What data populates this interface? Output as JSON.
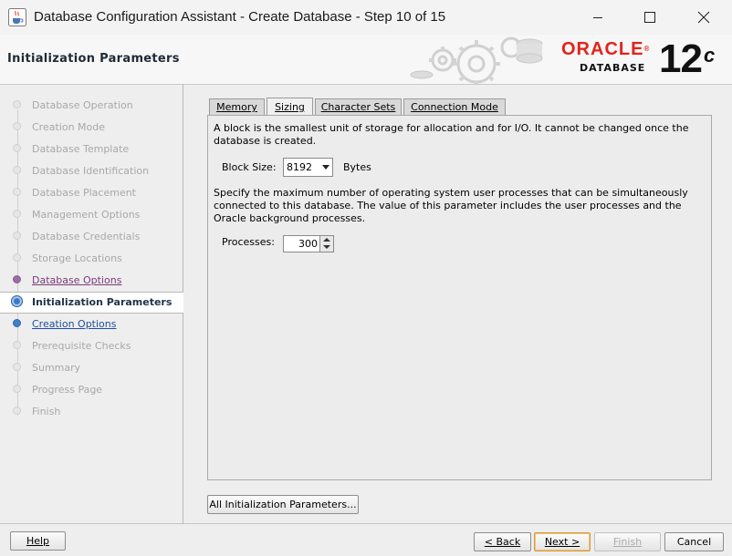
{
  "window": {
    "title": "Database Configuration Assistant - Create Database - Step 10 of 15",
    "icon": "java-coffee-icon"
  },
  "header": {
    "page_title": "Initialization Parameters",
    "brand_name": "ORACLE",
    "brand_reg": "®",
    "brand_product": "DATABASE",
    "version": "12",
    "version_suffix": "c"
  },
  "steps": [
    {
      "label": "Database Operation",
      "state": "disabled"
    },
    {
      "label": "Creation Mode",
      "state": "disabled"
    },
    {
      "label": "Database Template",
      "state": "disabled"
    },
    {
      "label": "Database Identification",
      "state": "disabled"
    },
    {
      "label": "Database Placement",
      "state": "disabled"
    },
    {
      "label": "Management Options",
      "state": "disabled"
    },
    {
      "label": "Database Credentials",
      "state": "disabled"
    },
    {
      "label": "Storage Locations",
      "state": "disabled"
    },
    {
      "label": "Database Options",
      "state": "visited"
    },
    {
      "label": "Initialization Parameters",
      "state": "current"
    },
    {
      "label": "Creation Options",
      "state": "link"
    },
    {
      "label": "Prerequisite Checks",
      "state": "disabled"
    },
    {
      "label": "Summary",
      "state": "disabled"
    },
    {
      "label": "Progress Page",
      "state": "disabled"
    },
    {
      "label": "Finish",
      "state": "disabled"
    }
  ],
  "tabs": [
    {
      "label": "Memory",
      "active": false
    },
    {
      "label": "Sizing",
      "active": true
    },
    {
      "label": "Character Sets",
      "active": false
    },
    {
      "label": "Connection Mode",
      "active": false
    }
  ],
  "sizing": {
    "block_desc": "A block is the smallest unit of storage for allocation and for I/O. It cannot be changed once the database is created.",
    "block_label": "Block Size:",
    "block_value": "8192",
    "block_unit": "Bytes",
    "process_desc": "Specify the maximum number of operating system user processes that can be simultaneously connected to this database. The value of this parameter includes the user processes and the Oracle background processes.",
    "process_label": "Processes:",
    "process_value": "300"
  },
  "buttons": {
    "all_params": "All Initialization Parameters...",
    "help": "Help",
    "back": "< Back",
    "next": "Next >",
    "finish": "Finish",
    "cancel": "Cancel"
  },
  "colors": {
    "oracle_red": "#e3231b",
    "current_step": "#3b79c4",
    "visited_step": "#9b6da4",
    "default_button_border": "#d69a3b"
  }
}
